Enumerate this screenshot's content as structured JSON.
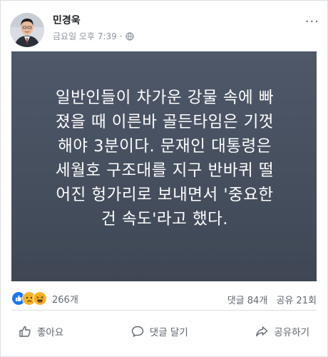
{
  "post": {
    "author": "민경욱",
    "timestamp": "금요일 오후 7:39",
    "dot": "·",
    "privacy_icon": "globe-icon",
    "menu_icon": "more-icon",
    "menu_glyph": "···",
    "text": "일반인들이 차가운 강물 속에 빠\n졌을 때 이른바 골든타임은 기껏\n해야 3분이다. 문재인 대통령은\n세월호 구조대를 지구 반바퀴 떨\n어진 헝가리로 보내면서 '중요한\n건 속도'라고 했다.",
    "background_color": "#4a5565"
  },
  "stats": {
    "reaction_icons": [
      "like-icon",
      "sad-icon",
      "haha-icon"
    ],
    "reaction_count": "266개",
    "comments": "댓글 84개",
    "shares": "공유 21회"
  },
  "actions": {
    "like": "좋아요",
    "comment": "댓글 달기",
    "share": "공유하기"
  },
  "colors": {
    "like_blue": "#1877f2",
    "emoji_yellow": "#f7b125",
    "muted_text": "#606770"
  }
}
